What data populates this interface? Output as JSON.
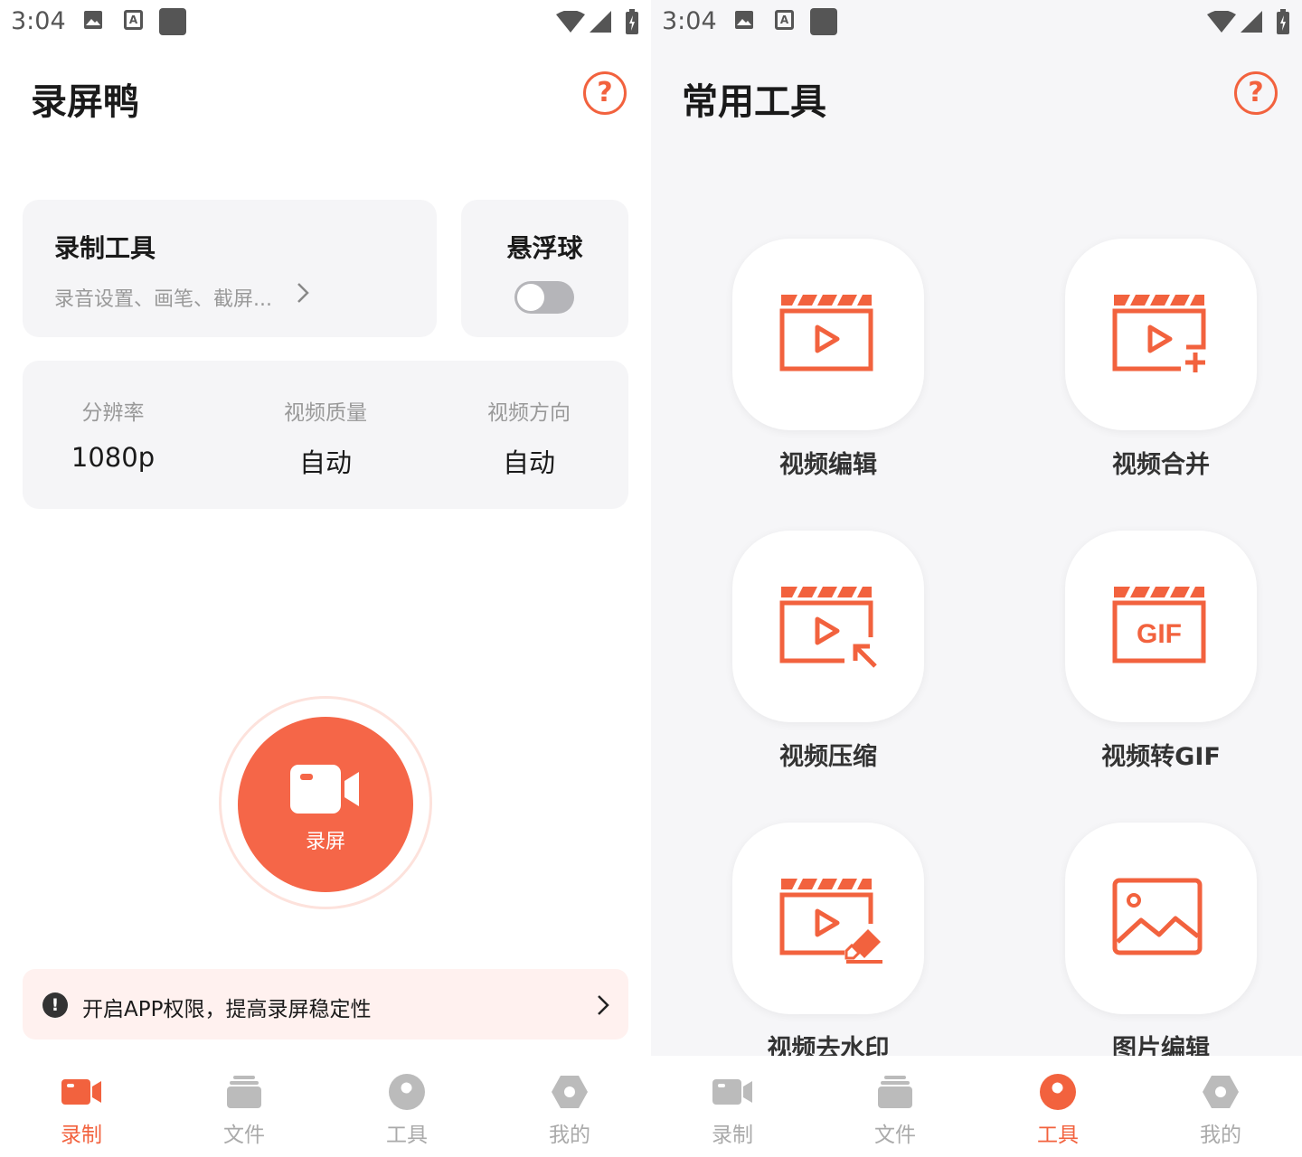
{
  "status_bar": {
    "time": "3:04"
  },
  "colors": {
    "accent": "#f2623e",
    "record_button": "#f56648",
    "card": "#f5f5f7",
    "muted": "#999999"
  },
  "left": {
    "title": "录屏鸭",
    "tools_card": {
      "title": "录制工具",
      "subtitle": "录音设置、画笔、截屏..."
    },
    "float_ball": {
      "title": "悬浮球",
      "enabled": false
    },
    "settings": [
      {
        "label": "分辨率",
        "value": "1080p"
      },
      {
        "label": "视频质量",
        "value": "自动"
      },
      {
        "label": "视频方向",
        "value": "自动"
      }
    ],
    "record_button": {
      "label": "录屏"
    },
    "permission_banner": {
      "text": "开启APP权限，提高录屏稳定性"
    }
  },
  "right": {
    "title": "常用工具",
    "tools": [
      {
        "label": "视频编辑",
        "icon": "video-edit-icon"
      },
      {
        "label": "视频合并",
        "icon": "video-merge-icon"
      },
      {
        "label": "视频压缩",
        "icon": "video-compress-icon"
      },
      {
        "label": "视频转GIF",
        "icon": "video-to-gif-icon",
        "badge": "GIF"
      },
      {
        "label": "视频去水印",
        "icon": "video-remove-watermark-icon"
      },
      {
        "label": "图片编辑",
        "icon": "image-edit-icon"
      }
    ]
  },
  "nav": {
    "items": [
      {
        "label": "录制",
        "icon": "camera-icon"
      },
      {
        "label": "文件",
        "icon": "folder-icon"
      },
      {
        "label": "工具",
        "icon": "wrench-icon"
      },
      {
        "label": "我的",
        "icon": "profile-icon"
      }
    ],
    "left_active": 0,
    "right_active": 2
  }
}
